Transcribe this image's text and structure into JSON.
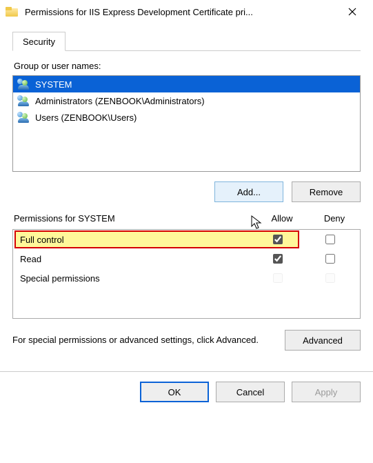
{
  "title": "Permissions for IIS Express Development Certificate pri...",
  "tab": "Security",
  "group_label": "Group or user names:",
  "users": [
    {
      "name": "SYSTEM",
      "selected": true
    },
    {
      "name": "Administrators (ZENBOOK\\Administrators)",
      "selected": false
    },
    {
      "name": "Users (ZENBOOK\\Users)",
      "selected": false
    }
  ],
  "buttons": {
    "add": "Add...",
    "remove": "Remove",
    "advanced": "Advanced",
    "ok": "OK",
    "cancel": "Cancel",
    "apply": "Apply"
  },
  "perm_header": {
    "title": "Permissions for SYSTEM",
    "allow": "Allow",
    "deny": "Deny"
  },
  "permissions": [
    {
      "name": "Full control",
      "allow": true,
      "deny": false,
      "highlight": true,
      "disabled": false
    },
    {
      "name": "Read",
      "allow": true,
      "deny": false,
      "highlight": false,
      "disabled": false
    },
    {
      "name": "Special permissions",
      "allow": false,
      "deny": false,
      "highlight": false,
      "disabled": true
    }
  ],
  "adv_text": "For special permissions or advanced settings, click Advanced."
}
